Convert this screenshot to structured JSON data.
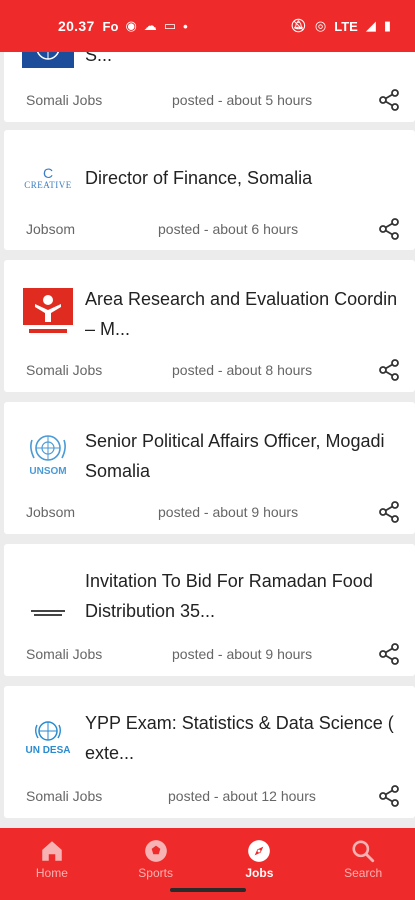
{
  "status_bar": {
    "time": "20.37",
    "notif_text": "Fo",
    "network": "LTE"
  },
  "jobs": [
    {
      "logo": "un-emblem-icon",
      "title_lines": [
        "S..."
      ],
      "source": "Somali Jobs",
      "posted": "posted - about 5 hours"
    },
    {
      "logo": "creative-logo-icon",
      "logo_text": "CREATIVE",
      "title_lines": [
        "Director of Finance, Somalia"
      ],
      "source": "Jobsom",
      "posted": "posted - about 6 hours"
    },
    {
      "logo": "save-the-children-icon",
      "title_lines": [
        "Area Research and Evaluation Coordin",
        "– M..."
      ],
      "source": "Somali Jobs",
      "posted": "posted - about 8 hours"
    },
    {
      "logo": "unsom-icon",
      "logo_text": "UNSOM",
      "title_lines": [
        "Senior Political Affairs Officer, Mogadi",
        "Somalia"
      ],
      "source": "Jobsom",
      "posted": "posted - about 9 hours"
    },
    {
      "logo": "red-crescent-icon",
      "title_lines": [
        "Invitation To Bid For Ramadan Food",
        "Distribution 35..."
      ],
      "source": "Somali Jobs",
      "posted": "posted - about 9 hours"
    },
    {
      "logo": "un-desa-icon",
      "logo_text": "UN DESA",
      "title_lines": [
        "YPP Exam: Statistics & Data Science (",
        "exte..."
      ],
      "source": "Somali Jobs",
      "posted": "posted - about 12 hours"
    }
  ],
  "nav": [
    {
      "label": "Home",
      "icon": "home-icon",
      "active": false
    },
    {
      "label": "Sports",
      "icon": "soccer-ball-icon",
      "active": false
    },
    {
      "label": "Jobs",
      "icon": "compass-icon",
      "active": true
    },
    {
      "label": "Search",
      "icon": "search-icon",
      "active": false
    }
  ],
  "colors": {
    "accent": "#ee2a2a",
    "background": "#ececec"
  }
}
